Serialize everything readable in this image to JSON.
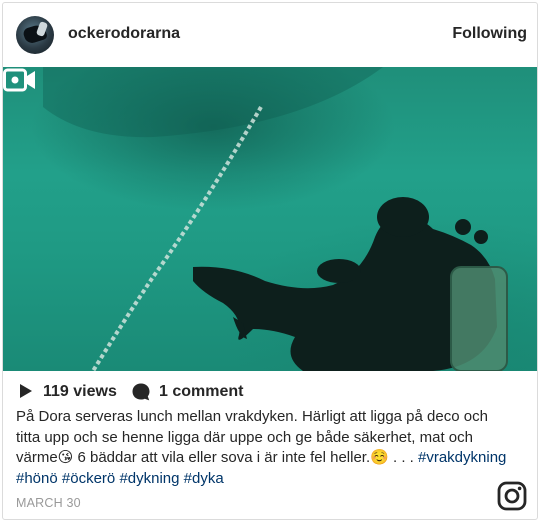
{
  "post": {
    "username": "ockerodorarna",
    "follow_label": "Following",
    "views": "119 views",
    "comments": "1 comment",
    "caption_text": "På Dora serveras lunch mellan vrakdyken. Härligt att ligga på deco och titta upp och se henne ligga där uppe och ge både säkerhet, mat och värme😘 6 bäddar att vila eller sova i är inte fel heller.☺️ . . . ",
    "hashtags": [
      "#vrakdykning",
      "#hönö",
      "#öckerö",
      "#dykning",
      "#dyka"
    ],
    "date": "MARCH 30"
  },
  "icons": {
    "avatar": "diver-avatar",
    "media_badge": "video-camera-icon",
    "views": "play-icon",
    "comments": "comment-bubble-icon",
    "brand": "instagram-icon"
  },
  "colors": {
    "text": "#262626",
    "hashtag": "#003569",
    "muted": "#999999",
    "border": "#dbdbdb",
    "water": "#22a08a"
  }
}
